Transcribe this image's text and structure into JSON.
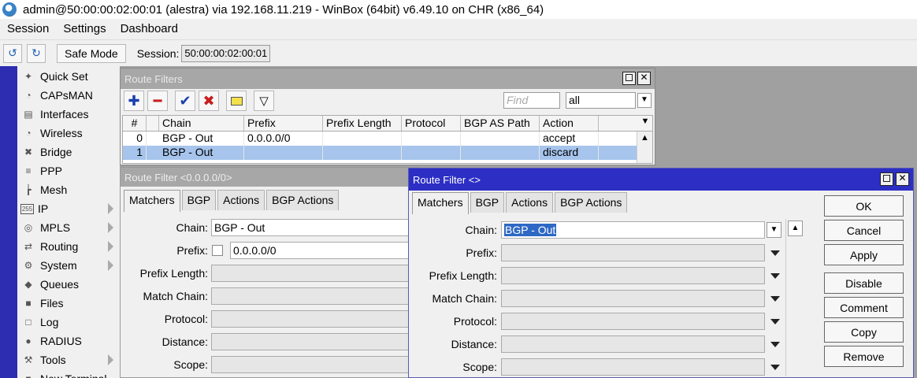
{
  "window": {
    "title": "admin@50:00:00:02:00:01 (alestra) via 192.168.11.219 - WinBox (64bit) v6.49.10 on CHR (x86_64)"
  },
  "menu": [
    "Session",
    "Settings",
    "Dashboard"
  ],
  "toolbar": {
    "undo_icon": "undo-icon",
    "redo_icon": "redo-icon",
    "safe_mode": "Safe Mode",
    "session_label": "Session:",
    "session_value": "50:00:00:02:00:01"
  },
  "sidebar": {
    "items": [
      {
        "label": "Quick Set",
        "icon": "wand-icon",
        "submenu": false
      },
      {
        "label": "CAPsMAN",
        "icon": "capsman-icon",
        "submenu": false
      },
      {
        "label": "Interfaces",
        "icon": "interfaces-icon",
        "submenu": false
      },
      {
        "label": "Wireless",
        "icon": "wireless-icon",
        "submenu": false
      },
      {
        "label": "Bridge",
        "icon": "bridge-icon",
        "submenu": false
      },
      {
        "label": "PPP",
        "icon": "ppp-icon",
        "submenu": false
      },
      {
        "label": "Mesh",
        "icon": "mesh-icon",
        "submenu": false
      },
      {
        "label": "IP",
        "icon": "ip-icon",
        "submenu": true,
        "icon_text": "255"
      },
      {
        "label": "MPLS",
        "icon": "mpls-icon",
        "submenu": true
      },
      {
        "label": "Routing",
        "icon": "routing-icon",
        "submenu": true
      },
      {
        "label": "System",
        "icon": "system-icon",
        "submenu": true
      },
      {
        "label": "Queues",
        "icon": "queues-icon",
        "submenu": false
      },
      {
        "label": "Files",
        "icon": "files-icon",
        "submenu": false
      },
      {
        "label": "Log",
        "icon": "log-icon",
        "submenu": false
      },
      {
        "label": "RADIUS",
        "icon": "radius-icon",
        "submenu": false
      },
      {
        "label": "Tools",
        "icon": "tools-icon",
        "submenu": true
      },
      {
        "label": "New Terminal",
        "icon": "terminal-icon",
        "submenu": false
      }
    ]
  },
  "route_filters": {
    "title": "Route Filters",
    "find_placeholder": "Find",
    "filter_value": "all",
    "columns": [
      "#",
      "",
      "Chain",
      "Prefix",
      "Prefix Length",
      "Protocol",
      "BGP AS Path",
      "Action"
    ],
    "rows": [
      {
        "num": "0",
        "chain": "BGP - Out",
        "prefix": "0.0.0.0/0",
        "prefix_length": "",
        "protocol": "",
        "bgp_as_path": "",
        "action": "accept",
        "selected": false
      },
      {
        "num": "1",
        "chain": "BGP - Out",
        "prefix": "",
        "prefix_length": "",
        "protocol": "",
        "bgp_as_path": "",
        "action": "discard",
        "selected": true
      }
    ]
  },
  "rf_detail": {
    "title": "Route Filter <0.0.0.0/0>",
    "tabs": [
      "Matchers",
      "BGP",
      "Actions",
      "BGP Actions"
    ],
    "fields": [
      {
        "label": "Chain:",
        "value": "BGP - Out"
      },
      {
        "label": "Prefix:",
        "value": "0.0.0.0/0"
      },
      {
        "label": "Prefix Length:",
        "value": ""
      },
      {
        "label": "Match Chain:",
        "value": ""
      },
      {
        "label": "Protocol:",
        "value": ""
      },
      {
        "label": "Distance:",
        "value": ""
      },
      {
        "label": "Scope:",
        "value": ""
      }
    ]
  },
  "rf_new": {
    "title": "Route Filter <>",
    "tabs": [
      "Matchers",
      "BGP",
      "Actions",
      "BGP Actions"
    ],
    "fields": [
      {
        "label": "Chain:",
        "value": "BGP - Out"
      },
      {
        "label": "Prefix:",
        "value": ""
      },
      {
        "label": "Prefix Length:",
        "value": ""
      },
      {
        "label": "Match Chain:",
        "value": ""
      },
      {
        "label": "Protocol:",
        "value": ""
      },
      {
        "label": "Distance:",
        "value": ""
      },
      {
        "label": "Scope:",
        "value": ""
      }
    ],
    "buttons": [
      "OK",
      "Cancel",
      "Apply",
      "Disable",
      "Comment",
      "Copy",
      "Remove"
    ]
  },
  "colors": {
    "active_title": "#2c2ec4",
    "inactive_title": "#a7a7a7",
    "selected_row": "#a6c4ec",
    "sidebar_strip": "#2c2db0",
    "workspace": "#a0a0a0"
  }
}
